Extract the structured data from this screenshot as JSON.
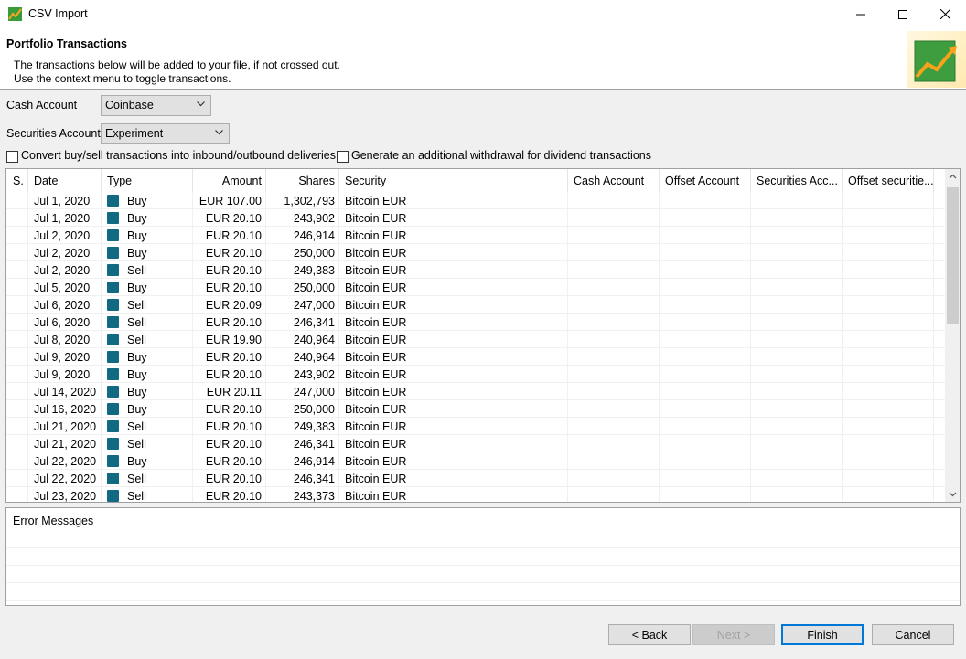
{
  "window": {
    "title": "CSV Import"
  },
  "header": {
    "title": "Portfolio Transactions",
    "desc1": "The transactions below will be added to your file, if not crossed out.",
    "desc2": "Use the context menu to toggle transactions."
  },
  "form": {
    "cash_account_label": "Cash Account",
    "cash_account_value": "Coinbase",
    "securities_account_label": "Securities Account",
    "securities_account_value": "Experiment",
    "convert_label": "Convert buy/sell transactions into inbound/outbound deliveries",
    "convert_checked": false,
    "withdrawal_label": "Generate an additional withdrawal for dividend transactions",
    "withdrawal_checked": false
  },
  "table": {
    "columns": [
      "S.",
      "Date",
      "Type",
      "Amount",
      "Shares",
      "Security",
      "Cash Account",
      "Offset Account",
      "Securities Acc...",
      "Offset securitie..."
    ],
    "rows": [
      {
        "date": "Jul 1, 2020",
        "type": "Buy",
        "amount": "EUR 107.00",
        "shares": "1,302,793",
        "security": "Bitcoin EUR"
      },
      {
        "date": "Jul 1, 2020",
        "type": "Buy",
        "amount": "EUR 20.10",
        "shares": "243,902",
        "security": "Bitcoin EUR"
      },
      {
        "date": "Jul 2, 2020",
        "type": "Buy",
        "amount": "EUR 20.10",
        "shares": "246,914",
        "security": "Bitcoin EUR"
      },
      {
        "date": "Jul 2, 2020",
        "type": "Buy",
        "amount": "EUR 20.10",
        "shares": "250,000",
        "security": "Bitcoin EUR"
      },
      {
        "date": "Jul 2, 2020",
        "type": "Sell",
        "amount": "EUR 20.10",
        "shares": "249,383",
        "security": "Bitcoin EUR"
      },
      {
        "date": "Jul 5, 2020",
        "type": "Buy",
        "amount": "EUR 20.10",
        "shares": "250,000",
        "security": "Bitcoin EUR"
      },
      {
        "date": "Jul 6, 2020",
        "type": "Sell",
        "amount": "EUR 20.09",
        "shares": "247,000",
        "security": "Bitcoin EUR"
      },
      {
        "date": "Jul 6, 2020",
        "type": "Sell",
        "amount": "EUR 20.10",
        "shares": "246,341",
        "security": "Bitcoin EUR"
      },
      {
        "date": "Jul 8, 2020",
        "type": "Sell",
        "amount": "EUR 19.90",
        "shares": "240,964",
        "security": "Bitcoin EUR"
      },
      {
        "date": "Jul 9, 2020",
        "type": "Buy",
        "amount": "EUR 20.10",
        "shares": "240,964",
        "security": "Bitcoin EUR"
      },
      {
        "date": "Jul 9, 2020",
        "type": "Buy",
        "amount": "EUR 20.10",
        "shares": "243,902",
        "security": "Bitcoin EUR"
      },
      {
        "date": "Jul 14, 2020",
        "type": "Buy",
        "amount": "EUR 20.11",
        "shares": "247,000",
        "security": "Bitcoin EUR"
      },
      {
        "date": "Jul 16, 2020",
        "type": "Buy",
        "amount": "EUR 20.10",
        "shares": "250,000",
        "security": "Bitcoin EUR"
      },
      {
        "date": "Jul 21, 2020",
        "type": "Sell",
        "amount": "EUR 20.10",
        "shares": "249,383",
        "security": "Bitcoin EUR"
      },
      {
        "date": "Jul 21, 2020",
        "type": "Sell",
        "amount": "EUR 20.10",
        "shares": "246,341",
        "security": "Bitcoin EUR"
      },
      {
        "date": "Jul 22, 2020",
        "type": "Buy",
        "amount": "EUR 20.10",
        "shares": "246,914",
        "security": "Bitcoin EUR"
      },
      {
        "date": "Jul 22, 2020",
        "type": "Sell",
        "amount": "EUR 20.10",
        "shares": "246,341",
        "security": "Bitcoin EUR"
      },
      {
        "date": "Jul 23, 2020",
        "type": "Sell",
        "amount": "EUR 20.10",
        "shares": "243,373",
        "security": "Bitcoin EUR"
      }
    ]
  },
  "errors": {
    "title": "Error Messages"
  },
  "buttons": {
    "back": "< Back",
    "next": "Next >",
    "finish": "Finish",
    "cancel": "Cancel"
  },
  "colors": {
    "type_icon": "#116a82",
    "default_button_border": "#0078d7"
  }
}
